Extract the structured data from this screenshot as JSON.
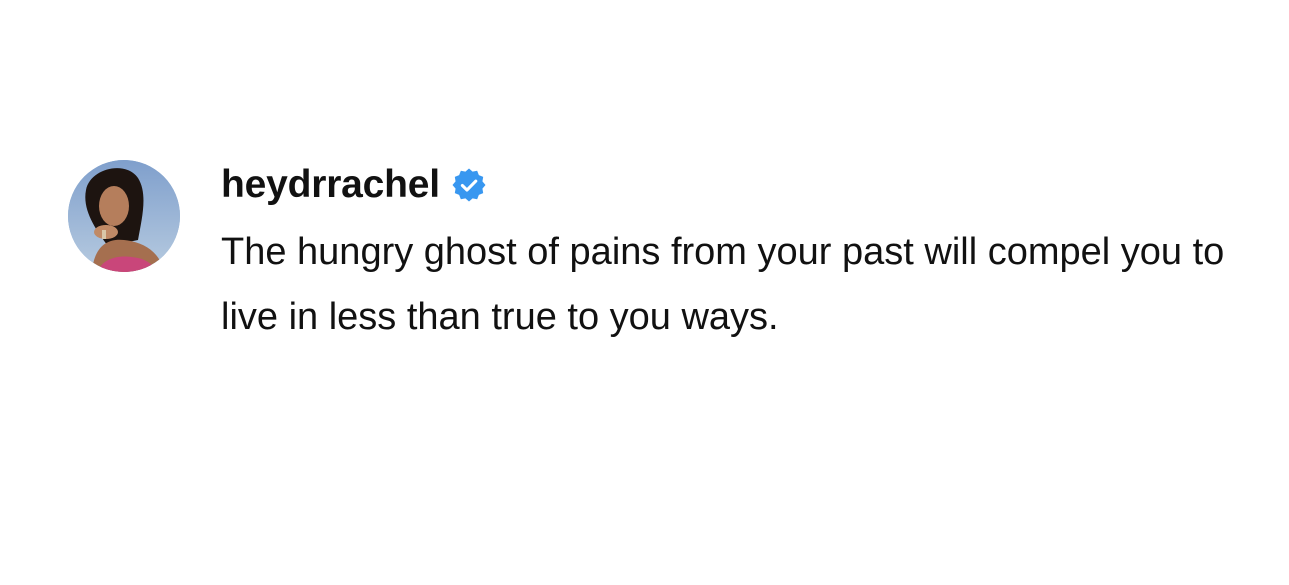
{
  "post": {
    "username": "heydrrachel",
    "verified": true,
    "verified_icon": "verified-badge-icon",
    "avatar_icon": "profile-avatar",
    "caption": "The hungry ghost of pains from your past will compel you to live in less than true to you ways."
  },
  "colors": {
    "background": "#ffffff",
    "text": "#111111",
    "verified_blue": "#3897f0"
  }
}
